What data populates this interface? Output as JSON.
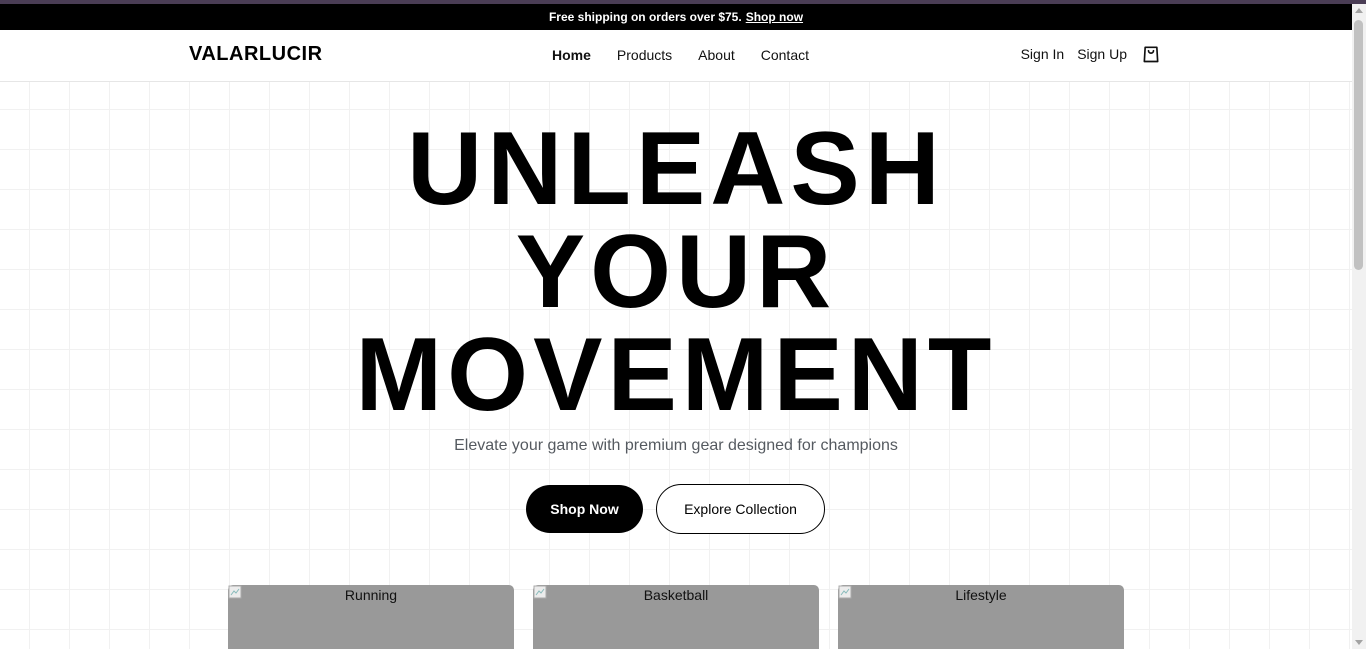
{
  "announcement": {
    "text": "Free shipping on orders over $75.",
    "link": "Shop now"
  },
  "header": {
    "logo": "VALARLUCIR",
    "nav": [
      "Home",
      "Products",
      "About",
      "Contact"
    ],
    "active_nav": "Home",
    "sign_in": "Sign In",
    "sign_up": "Sign Up",
    "cart_icon": "shopping-bag-icon"
  },
  "hero": {
    "headline_line1": "UNLEASH",
    "headline_line2": "YOUR",
    "headline_line3": "MOVEMENT",
    "subtitle": "Elevate your game with premium gear designed for champions",
    "primary_button": "Shop Now",
    "secondary_button": "Explore Collection"
  },
  "categories": [
    {
      "label": "Running"
    },
    {
      "label": "Basketball"
    },
    {
      "label": "Lifestyle"
    }
  ],
  "colors": {
    "accent": "#000000",
    "announcement_bg": "#000000",
    "card_placeholder": "#999999",
    "subtitle": "#555a60"
  }
}
